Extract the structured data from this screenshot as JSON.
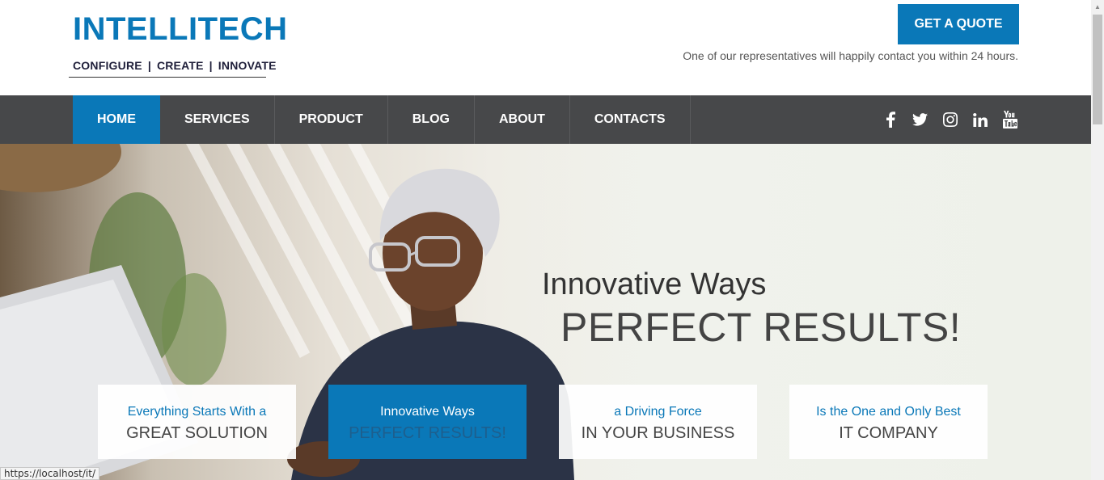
{
  "brand": {
    "name": "INTELLITECH",
    "tagline": [
      "CONFIGURE",
      "CREATE",
      "INNOVATE"
    ],
    "tagline_separator": "|"
  },
  "header": {
    "quote_button": "GET A QUOTE",
    "quote_note": "One of our representatives will happily contact you within 24 hours."
  },
  "nav": {
    "items": [
      {
        "label": "HOME",
        "active": true
      },
      {
        "label": "SERVICES",
        "active": false
      },
      {
        "label": "PRODUCT",
        "active": false
      },
      {
        "label": "BLOG",
        "active": false
      },
      {
        "label": "ABOUT",
        "active": false
      },
      {
        "label": "CONTACTS",
        "active": false
      }
    ],
    "socials": [
      "facebook-icon",
      "twitter-icon",
      "instagram-icon",
      "linkedin-icon",
      "youtube-icon"
    ]
  },
  "hero": {
    "title": "Innovative Ways",
    "subtitle": "PERFECT RESULTS!",
    "cards": [
      {
        "line1": "Everything Starts With a",
        "line2": "GREAT SOLUTION",
        "active": false
      },
      {
        "line1": "Innovative Ways",
        "line2": "PERFECT RESULTS!",
        "active": true
      },
      {
        "line1": "a Driving Force",
        "line2": "IN YOUR BUSINESS",
        "active": false
      },
      {
        "line1": "Is the One and Only Best",
        "line2": "IT COMPANY",
        "active": false
      }
    ]
  },
  "status_bar": {
    "url": "https://localhost/it/"
  },
  "colors": {
    "brand_blue": "#0a78b8",
    "nav_bg": "#47484a"
  }
}
